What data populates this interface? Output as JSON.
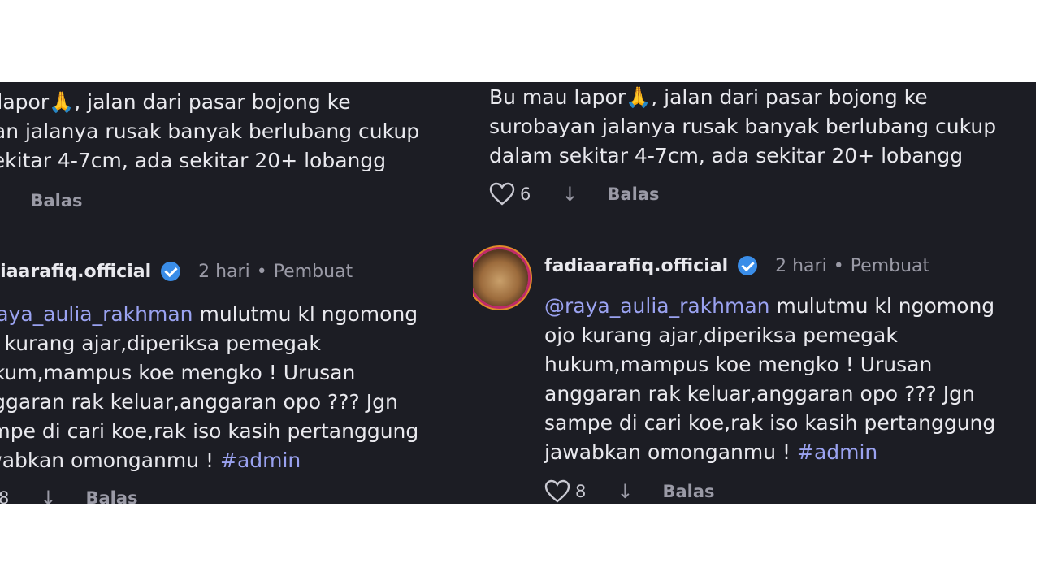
{
  "comment": {
    "lines": [
      "Bu mau lapor",
      ", jalan dari pasar bojong ke",
      "surobayan jalanya rusak banyak berlubang cukup",
      "dalam sekitar 4-7cm, ada sekitar 20+ lobangg"
    ],
    "likes": "6",
    "reply_label": "Balas"
  },
  "reply": {
    "username": "fadiaarafiq.official",
    "time": "2 hari",
    "creator_label": "Pembuat",
    "mention": "@raya_aulia_rakhman",
    "line1_rest": " mulutmu kl ngomong",
    "line2": "ojo kurang ajar,diperiksa pemegak",
    "line3": "hukum,mampus koe mengko ! Urusan",
    "line4": "anggaran rak keluar,anggaran opo ??? Jgn",
    "line5": "sampe di cari koe,rak iso kasih pertanggung",
    "line6_start": "jawabkan omonganmu ! ",
    "hashtag": "#admin",
    "likes": "8",
    "reply_label": "Balas"
  },
  "icons": {
    "emoji": "pray-emoji-icon",
    "like": "heart-icon",
    "download": "arrow-down-icon",
    "verified": "verified-badge-icon"
  },
  "colors": {
    "background": "#1c1d24",
    "text": "#e9e9ee",
    "muted": "#9a9aa6",
    "mention": "#9aa2f0",
    "verified": "#3a8de8"
  }
}
